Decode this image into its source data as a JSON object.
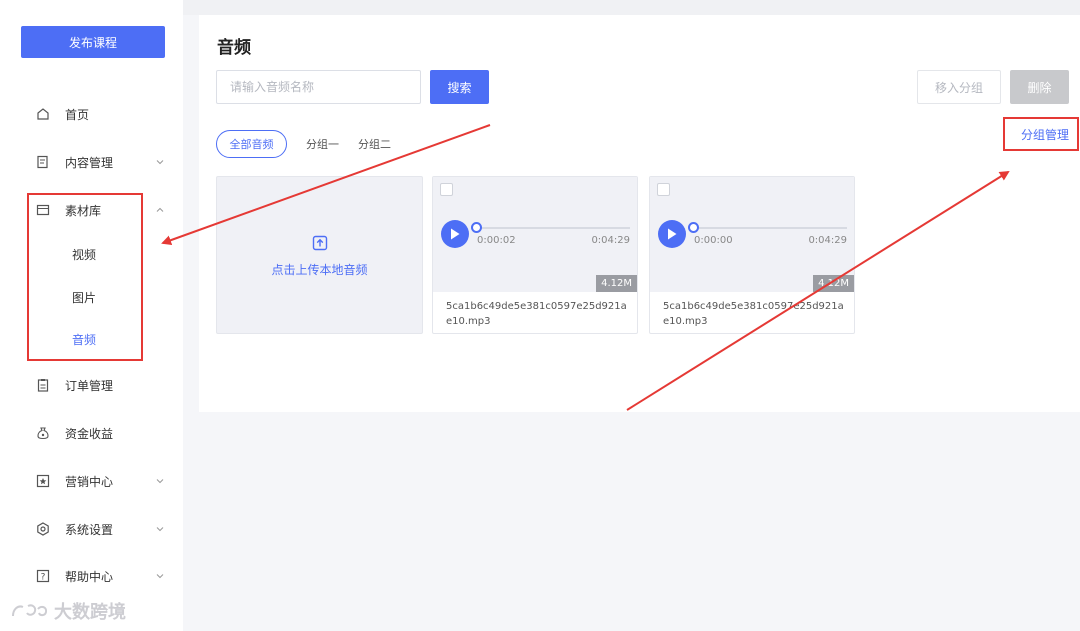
{
  "sidebar": {
    "publish_label": "发布课程",
    "items": [
      {
        "label": "首页",
        "icon": "home-icon"
      },
      {
        "label": "内容管理",
        "icon": "content-icon"
      },
      {
        "label": "素材库",
        "icon": "folder-icon"
      },
      {
        "label": "订单管理",
        "icon": "clipboard-icon"
      },
      {
        "label": "资金收益",
        "icon": "money-bag-icon"
      },
      {
        "label": "营销中心",
        "icon": "star-badge-icon"
      },
      {
        "label": "系统设置",
        "icon": "gear-icon"
      },
      {
        "label": "帮助中心",
        "icon": "question-icon"
      }
    ],
    "sub_items": [
      {
        "label": "视频",
        "active": false
      },
      {
        "label": "图片",
        "active": false
      },
      {
        "label": "音频",
        "active": true
      }
    ]
  },
  "main": {
    "title": "音频",
    "search": {
      "placeholder": "请输入音频名称",
      "value": "",
      "button_label": "搜索"
    },
    "move_group_label": "移入分组",
    "delete_label": "删除",
    "tabs": [
      {
        "label": "全部音频",
        "active": true
      },
      {
        "label": "分组一",
        "active": false
      },
      {
        "label": "分组二",
        "active": false
      }
    ],
    "group_manage_label": "分组管理",
    "upload_label": "点击上传本地音频",
    "audios": [
      {
        "current_time": "0:00:02",
        "total_time": "0:04:29",
        "size": "4.12M",
        "file_name": "5ca1b6c49de5e381c0597e25d921ae10.mp3"
      },
      {
        "current_time": "0:00:00",
        "total_time": "0:04:29",
        "size": "4.12M",
        "file_name": "5ca1b6c49de5e381c0597e25d921ae10.mp3"
      }
    ]
  },
  "watermark": "大数跨境",
  "colors": {
    "accent": "#4d6ef5",
    "annotation": "#e53935",
    "disabled": "#c8c9cc"
  }
}
